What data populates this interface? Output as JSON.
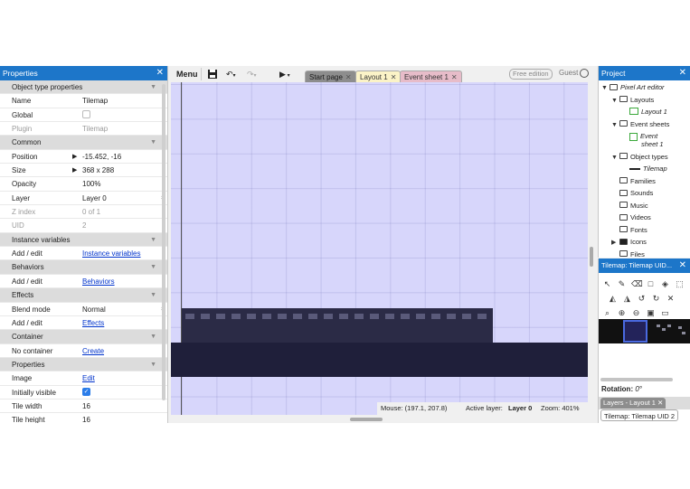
{
  "properties": {
    "title": "Properties",
    "close_glyph": "✕",
    "rows": [
      {
        "type": "section",
        "label": "Object type properties"
      },
      {
        "type": "text",
        "label": "Name",
        "value": "Tilemap"
      },
      {
        "type": "checkbox",
        "label": "Global",
        "checked": false
      },
      {
        "type": "text",
        "label": "Plugin",
        "value": "Tilemap",
        "dim": true
      },
      {
        "type": "section",
        "label": "Common"
      },
      {
        "type": "expand",
        "label": "Position",
        "value": "-15.452, -16"
      },
      {
        "type": "expand",
        "label": "Size",
        "value": "368 x 288"
      },
      {
        "type": "text",
        "label": "Opacity",
        "value": "100%"
      },
      {
        "type": "select",
        "label": "Layer",
        "value": "Layer 0"
      },
      {
        "type": "text",
        "label": "Z index",
        "value": "0 of 1",
        "dim": true
      },
      {
        "type": "text",
        "label": "UID",
        "value": "2",
        "dim": true
      },
      {
        "type": "section",
        "label": "Instance variables"
      },
      {
        "type": "link",
        "label": "Add / edit",
        "value": "Instance variables"
      },
      {
        "type": "section",
        "label": "Behaviors"
      },
      {
        "type": "link",
        "label": "Add / edit",
        "value": "Behaviors"
      },
      {
        "type": "section",
        "label": "Effects"
      },
      {
        "type": "select",
        "label": "Blend mode",
        "value": "Normal"
      },
      {
        "type": "link",
        "label": "Add / edit",
        "value": "Effects"
      },
      {
        "type": "section",
        "label": "Container"
      },
      {
        "type": "link",
        "label": "No container",
        "value": "Create"
      },
      {
        "type": "section",
        "label": "Properties"
      },
      {
        "type": "link",
        "label": "Image",
        "value": "Edit"
      },
      {
        "type": "checkbox",
        "label": "Initially visible",
        "checked": true
      },
      {
        "type": "text",
        "label": "Tile width",
        "value": "16"
      },
      {
        "type": "text",
        "label": "Tile height",
        "value": "16"
      }
    ]
  },
  "toolbar": {
    "menu_label": "Menu",
    "tabs": [
      {
        "label": "Start page",
        "close": "✕",
        "bg": "#8d8d8d",
        "color": "#1a1a1a"
      },
      {
        "label": "Layout 1",
        "close": "✕",
        "bg": "#fbf3c7",
        "color": "#333333"
      },
      {
        "label": "Event sheet 1",
        "close": "✕",
        "bg": "#e7bcc9",
        "color": "#333333"
      }
    ],
    "free_edition": "Free edition",
    "guest": "Guest"
  },
  "status": {
    "mouse": "Mouse: (197.1, 207.8)",
    "active_layer_label": "Active layer:",
    "active_layer_value": "Layer 0",
    "zoom": "Zoom: 401%"
  },
  "project": {
    "title": "Project",
    "close_glyph": "✕",
    "tree": [
      {
        "label": "Pixel Art editor",
        "icon": "folder-icon",
        "indent": 0,
        "twisty": "▼",
        "italic": true
      },
      {
        "label": "Layouts",
        "icon": "folder-icon",
        "indent": 1,
        "twisty": "▼"
      },
      {
        "label": "Layout 1",
        "icon": "layout-icon",
        "indent": 2,
        "italic": true
      },
      {
        "label": "Event sheets",
        "icon": "folder-icon",
        "indent": 1,
        "twisty": "▼"
      },
      {
        "label": "Event",
        "label2": "sheet 1",
        "icon": "event-sheet-icon",
        "indent": 2,
        "italic": true
      },
      {
        "label": "Object types",
        "icon": "folder-icon",
        "indent": 1,
        "twisty": "▼"
      },
      {
        "label": "Tilemap",
        "icon": "tilemap-icon",
        "indent": 2,
        "italic": true
      },
      {
        "label": "Families",
        "icon": "folder-icon",
        "indent": 1
      },
      {
        "label": "Sounds",
        "icon": "folder-icon",
        "indent": 1
      },
      {
        "label": "Music",
        "icon": "folder-icon",
        "indent": 1
      },
      {
        "label": "Videos",
        "icon": "folder-icon",
        "indent": 1
      },
      {
        "label": "Fonts",
        "icon": "folder-icon",
        "indent": 1
      },
      {
        "label": "Icons",
        "icon": "folder-solid-icon",
        "indent": 1,
        "twisty": "▶"
      },
      {
        "label": "Files",
        "icon": "folder-icon",
        "indent": 1
      }
    ]
  },
  "tilemap_panel": {
    "title": "Tilemap: Tilemap UID...",
    "close_glyph": "✕",
    "tools_row1": [
      {
        "name": "pointer-tool-icon",
        "glyph": "↖"
      },
      {
        "name": "pencil-tool-icon",
        "glyph": "✎"
      },
      {
        "name": "eraser-tool-icon",
        "glyph": "⌫"
      },
      {
        "name": "rectangle-tool-icon",
        "glyph": "□"
      },
      {
        "name": "fill-tool-icon",
        "glyph": "◈"
      },
      {
        "name": "selection-tool-icon",
        "glyph": "⬚"
      }
    ],
    "tools_row2": [
      {
        "name": "mirror-icon",
        "glyph": "◭"
      },
      {
        "name": "flip-icon",
        "glyph": "◮"
      },
      {
        "name": "rotate-ccw-icon",
        "glyph": "↺"
      },
      {
        "name": "rotate-cw-icon",
        "glyph": "↻"
      },
      {
        "name": "reset-icon",
        "glyph": "✕"
      }
    ],
    "tools_row3": [
      {
        "name": "zoom-tool-icon",
        "glyph": "⌕"
      },
      {
        "name": "zoom-in-icon",
        "glyph": "⊕"
      },
      {
        "name": "zoom-out-icon",
        "glyph": "⊖"
      },
      {
        "name": "save-icon",
        "glyph": "▣"
      },
      {
        "name": "folder-open-icon",
        "glyph": "▭"
      }
    ],
    "rotation_label": "Rotation:",
    "rotation_value": "0°",
    "layers_tab": "Layers - Layout 1",
    "layers_tab_close": "✕",
    "bottom_tab": "Tilemap: Tilemap UID 2"
  },
  "colors": {
    "panel_header": "#1d76c9",
    "canvas_bg": "#d7d6fb",
    "tile_dark": "#1f1f3a",
    "tile_top": "#2b2b46",
    "link": "#0033cc"
  }
}
